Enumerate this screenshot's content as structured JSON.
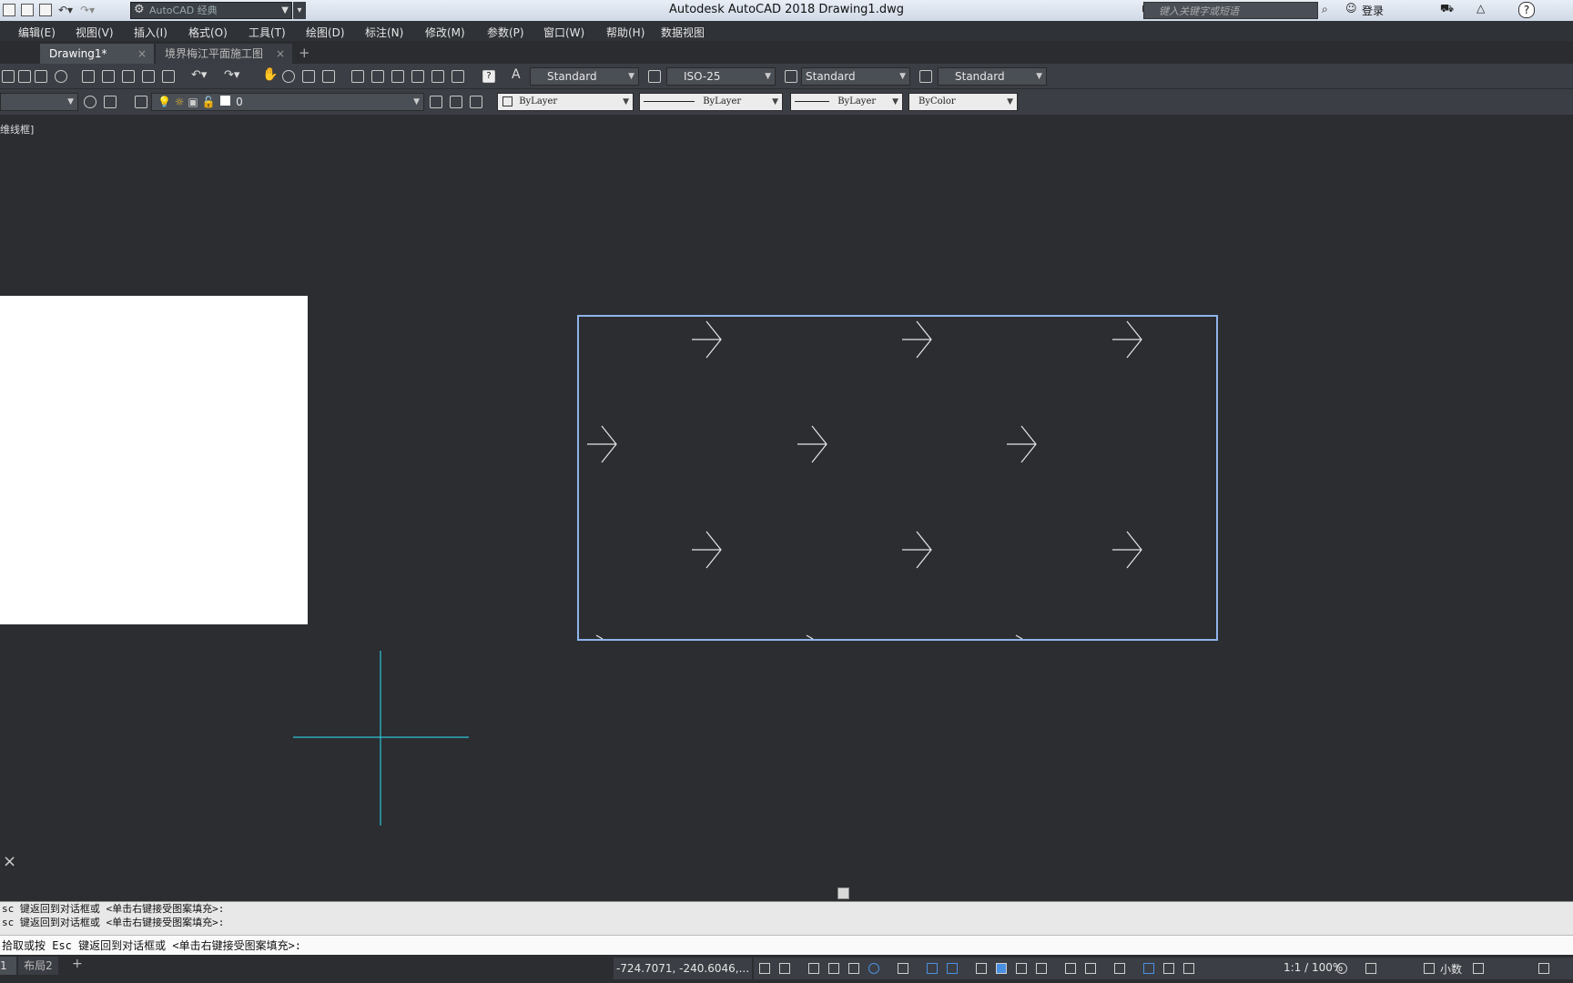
{
  "titlebar": {
    "workspace": "AutoCAD 经典",
    "title": "Autodesk AutoCAD 2018    Drawing1.dwg",
    "search_placeholder": "键入关键字或短语",
    "login": "登录",
    "help": "?"
  },
  "menu": [
    "编辑(E)",
    "视图(V)",
    "插入(I)",
    "格式(O)",
    "工具(T)",
    "绘图(D)",
    "标注(N)",
    "修改(M)",
    "参数(P)",
    "窗口(W)",
    "帮助(H)",
    "数据视图"
  ],
  "tabs": [
    {
      "label": "Drawing1*",
      "close": "×"
    },
    {
      "label": "境界梅江平面施工图",
      "close": "×"
    }
  ],
  "tab_add": "+",
  "toolbar1": {
    "text_style": "Standard",
    "dim_style": "ISO-25",
    "table_style": "Standard",
    "mleader_style": "Standard"
  },
  "toolbar2": {
    "layer": "0",
    "color": "ByLayer",
    "linetype": "ByLayer",
    "lineweight": "ByLayer",
    "plotstyle": "ByColor"
  },
  "viewport_label": "维线框]",
  "close_icon": "×",
  "command": {
    "history": [
      "sc  键返回到对话框或 <单击右键接受图案填充>:",
      "sc  键返回到对话框或 <单击右键接受图案填充>:"
    ],
    "prompt": "拾取或按 Esc 键返回到对话框或 <单击右键接受图案填充>:"
  },
  "status": {
    "layout1": "1",
    "layout2": "布局2",
    "layout_add": "+",
    "coords": "-724.7071, -240.6046,...",
    "scale": "1:1 / 100%",
    "units": "小数"
  },
  "colors": {
    "canvas": "#2b2d31",
    "selection": "#8fb3ea",
    "crosshair": "#2ec4d6",
    "hatch": "#e6e6e6"
  }
}
